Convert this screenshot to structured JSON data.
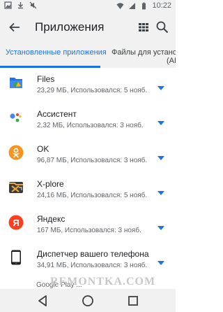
{
  "statusbar": {
    "time": "10:22"
  },
  "appbar": {
    "title": "Приложения"
  },
  "tabs": {
    "installed": "Установленные приложения",
    "apk": "Файлы для устано",
    "apk_tail": "(APK"
  },
  "apps": [
    {
      "name": "Files",
      "desc": "23,29 МБ, Использовался: 5 нояб.",
      "icon": "files-icon"
    },
    {
      "name": "Ассистент",
      "desc": "2,32 МБ, Использовался: 3 нояб.",
      "icon": "assistant-icon"
    },
    {
      "name": "OK",
      "desc": "96,87 МБ, Использовался: 3 нояб.",
      "icon": "ok-icon"
    },
    {
      "name": "X-plore",
      "desc": "24,16 МБ, Использовался: 5 нояб.",
      "icon": "xplore-icon"
    },
    {
      "name": "Яндекс",
      "desc": "167 МБ, Использовался: 3 нояб.",
      "icon": "yandex-icon"
    },
    {
      "name": "Диспетчер вашего телефона",
      "desc": "34,91 МБ, Использовался: 3 нояб.",
      "icon": "phone-manager-icon"
    }
  ],
  "partial_row": "Google Play ...",
  "watermark": "REMONTKA.COM",
  "colors": {
    "accent": "#1a73e8",
    "bar": "#f1f1f1"
  }
}
